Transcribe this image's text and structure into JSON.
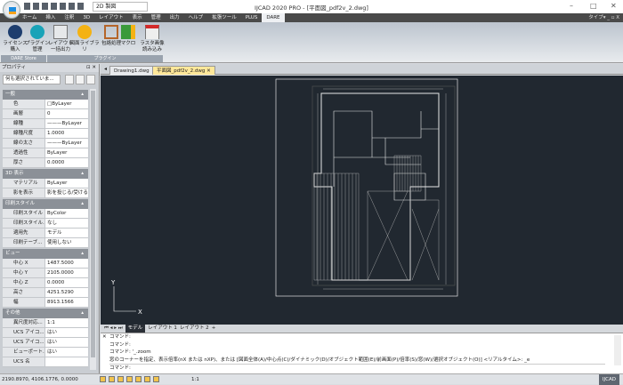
{
  "app": {
    "title": "IJCAD 2020 PRO - [平面図_pdf2v_2.dwg]",
    "workspace": "2D 製図"
  },
  "menu": {
    "tabs": [
      "ホーム",
      "挿入",
      "注釈",
      "3D",
      "レイアウト",
      "表示",
      "管理",
      "出力",
      "ヘルプ",
      "拡張ツール",
      "PLUS",
      "DARE"
    ],
    "active": "DARE",
    "right": "タイプ▾ _ ▫ X"
  },
  "ribbon": {
    "buttons": [
      {
        "label": "ライセンス\n購入",
        "icon": "cart-icon"
      },
      {
        "label": "プラグイン\n管理",
        "icon": "plug-icon"
      },
      {
        "label": "レイアウト\n一括出力",
        "icon": "layout-export-icon"
      },
      {
        "label": "図面ライブラリ",
        "icon": "library-icon"
      },
      {
        "label": "包絡処理",
        "icon": "envelope-icon"
      },
      {
        "label": "マクロ",
        "icon": "macro-icon"
      },
      {
        "label": "ラスタ画像\n読み込み",
        "icon": "raster-image-icon"
      }
    ],
    "groups": [
      "DARE Store",
      "プラグイン"
    ]
  },
  "properties": {
    "title": "プロパティ",
    "selection": "何も選択されていま...",
    "sections": [
      {
        "name": "一般",
        "rows": [
          [
            "色",
            "□ByLayer"
          ],
          [
            "画層",
            "0"
          ],
          [
            "線種",
            "———ByLayer"
          ],
          [
            "線種尺度",
            "1.0000"
          ],
          [
            "線の太さ",
            "———ByLayer"
          ],
          [
            "透過性",
            "ByLayer"
          ],
          [
            "厚さ",
            "0.0000"
          ]
        ]
      },
      {
        "name": "3D 表示",
        "rows": [
          [
            "マテリアル",
            "ByLayer"
          ],
          [
            "影を表示",
            "影を投じる/受ける"
          ]
        ]
      },
      {
        "name": "印刷スタイル",
        "rows": [
          [
            "印刷スタイル",
            "ByColor"
          ],
          [
            "印刷スタイル...",
            "なし"
          ],
          [
            "適用先",
            "モデル"
          ],
          [
            "印刷テーブ...",
            "使用しない"
          ]
        ]
      },
      {
        "name": "ビュー",
        "rows": [
          [
            "中心 X",
            "1487.5000"
          ],
          [
            "中心 Y",
            "2105.0000"
          ],
          [
            "中心 Z",
            "0.0000"
          ],
          [
            "高さ",
            "4251.5290"
          ],
          [
            "幅",
            "8913.1566"
          ]
        ]
      },
      {
        "name": "その他",
        "rows": [
          [
            "異尺度対応...",
            "1:1"
          ],
          [
            "UCS アイコ...",
            "はい"
          ],
          [
            "UCS アイコ...",
            "はい"
          ],
          [
            "ビューポート...",
            "はい"
          ],
          [
            "UCS 名",
            ""
          ]
        ]
      }
    ]
  },
  "doc_tabs": [
    "Drawing1.dwg",
    "平面図_pdf2v_2.dwg"
  ],
  "layout_tabs": [
    "モデル",
    "レイアウト 1",
    "レイアウト 2",
    "+"
  ],
  "command": {
    "lines": [
      "コマンド:",
      "コマンド:",
      "コマンド: '_.zoom",
      "窓のコーナーを指定、表示倍率(nX または nXP)、または [図面全体(A)/中心点(C)/ダイナミック(D)/オブジェクト範囲(E)/前画面(P)/倍率(S)/窓(W)/選択オブジェクト(O)] <リアルタイム>: _e"
    ],
    "prompt": "コマンド:"
  },
  "status": {
    "coords": "2190.8970, 4106.1776, 0.0000",
    "scale": "1:1",
    "app": "IJCAD"
  }
}
